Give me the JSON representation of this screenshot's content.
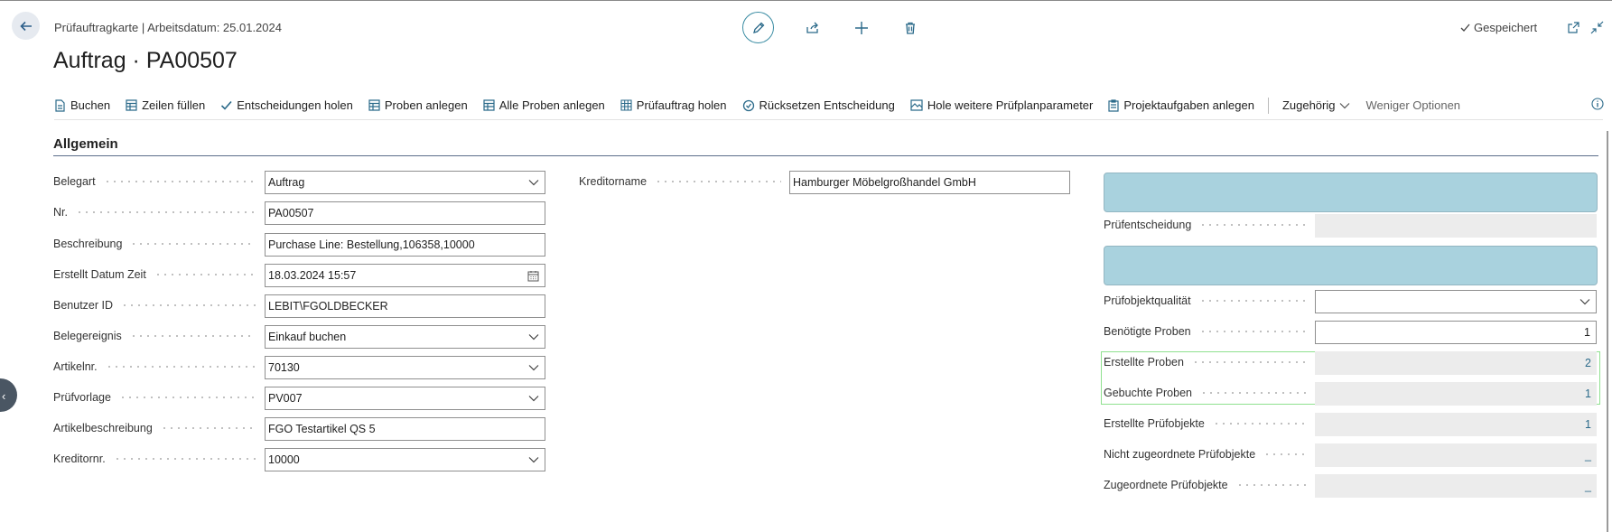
{
  "header": {
    "breadcrumb": "Prüfauftragkarte | Arbeitsdatum: 25.01.2024",
    "title": "Auftrag · PA00507",
    "saved_label": "Gespeichert"
  },
  "toolbar": {
    "items": [
      {
        "label": "Buchen",
        "icon": "post-icon"
      },
      {
        "label": "Zeilen füllen",
        "icon": "table-icon"
      },
      {
        "label": "Entscheidungen holen",
        "icon": "check-icon"
      },
      {
        "label": "Proben anlegen",
        "icon": "table-icon"
      },
      {
        "label": "Alle Proben anlegen",
        "icon": "table-icon"
      },
      {
        "label": "Prüfauftrag holen",
        "icon": "grid-icon"
      },
      {
        "label": "Rücksetzen Entscheidung",
        "icon": "reset-icon"
      },
      {
        "label": "Hole weitere Prüfplanparameter",
        "icon": "image-icon"
      },
      {
        "label": "Projektaufgaben anlegen",
        "icon": "clipboard-icon"
      }
    ],
    "related_label": "Zugehörig",
    "fewer_options_label": "Weniger Optionen"
  },
  "section": {
    "title": "Allgemein"
  },
  "left_fields": [
    {
      "label": "Belegart",
      "value": "Auftrag",
      "control": "dropdown"
    },
    {
      "label": "Nr.",
      "value": "PA00507",
      "control": "text"
    },
    {
      "label": "Beschreibung",
      "value": "Purchase Line: Bestellung,106358,10000",
      "control": "text"
    },
    {
      "label": "Erstellt Datum Zeit",
      "value": "18.03.2024 15:57",
      "control": "date"
    },
    {
      "label": "Benutzer ID",
      "value": "LEBIT\\FGOLDBECKER",
      "control": "text"
    },
    {
      "label": "Belegereignis",
      "value": "Einkauf buchen",
      "control": "dropdown"
    },
    {
      "label": "Artikelnr.",
      "value": "70130",
      "control": "dropdown"
    },
    {
      "label": "Prüfvorlage",
      "value": "PV007",
      "control": "dropdown"
    },
    {
      "label": "Artikelbeschreibung",
      "value": "FGO Testartikel QS 5",
      "control": "text"
    },
    {
      "label": "Kreditornr.",
      "value": "10000",
      "control": "dropdown"
    }
  ],
  "middle_fields": [
    {
      "label": "Kreditorname",
      "value": "Hamburger Möbelgroßhandel GmbH"
    }
  ],
  "right_fields": {
    "pruefentscheidung": {
      "label": "Prüfentscheidung",
      "value": ""
    },
    "pruefobjektqualitaet": {
      "label": "Prüfobjektqualität",
      "value": ""
    },
    "benoetigte_proben": {
      "label": "Benötigte Proben",
      "value": "1"
    },
    "erstellte_proben": {
      "label": "Erstellte Proben",
      "value": "2"
    },
    "gebuchte_proben": {
      "label": "Gebuchte Proben",
      "value": "1"
    },
    "erstellte_pruefobjekte": {
      "label": "Erstellte Prüfobjekte",
      "value": "1"
    },
    "nicht_zugeordnete": {
      "label": "Nicht zugeordnete Prüfobjekte",
      "value": "_"
    },
    "zugeordnete": {
      "label": "Zugeordnete Prüfobjekte",
      "value": "_"
    }
  }
}
